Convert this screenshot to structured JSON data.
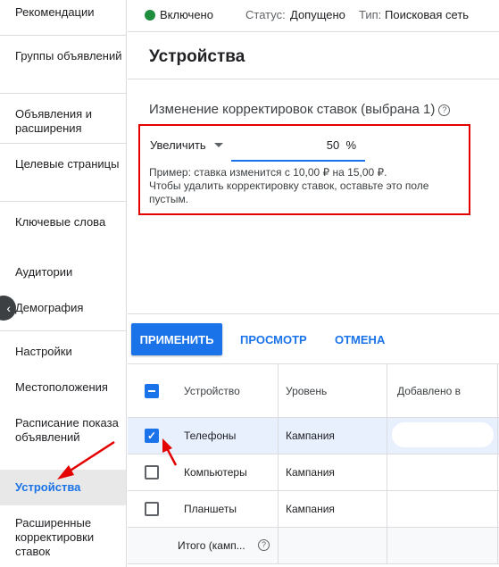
{
  "sidebar": {
    "items": [
      {
        "label": "Рекомендации"
      },
      {
        "label": "Группы объявлений"
      },
      {
        "label": "Объявления и расширения"
      },
      {
        "label": "Целевые страницы"
      },
      {
        "label": "Ключевые слова"
      },
      {
        "label": "Аудитории"
      },
      {
        "label": "Демография"
      },
      {
        "label": "Настройки"
      },
      {
        "label": "Местоположения"
      },
      {
        "label": "Расписание показа объявлений"
      },
      {
        "label": "Устройства"
      },
      {
        "label": "Расширенные корректировки ставок"
      }
    ],
    "active_index": 10
  },
  "statusbar": {
    "state": "Включено",
    "status_label": "Статус:",
    "status_value": "Допущено",
    "type_label": "Тип:",
    "type_value": "Поисковая сеть",
    "state_color": "#1e8e3e"
  },
  "header": {
    "title": "Устройства"
  },
  "panel": {
    "title": "Изменение корректировок ставок (выбрана 1)",
    "direction": "Увеличить",
    "percent_value": "50",
    "percent_unit": "%",
    "example_line1": "Пример: ставка изменится с 10,00 ₽ на 15,00 ₽.",
    "example_line2": "Чтобы удалить корректировку ставок, оставьте это поле пустым."
  },
  "actions": {
    "apply_label": "ПРИМЕНИТЬ",
    "preview_label": "ПРОСМОТР",
    "cancel_label": "ОТМЕНА"
  },
  "table": {
    "headers": {
      "device": "Устройство",
      "level": "Уровень",
      "added": "Добавлено в"
    },
    "rows": [
      {
        "device": "Телефоны",
        "level": "Кампания",
        "checked": true
      },
      {
        "device": "Компьютеры",
        "level": "Кампания",
        "checked": false
      },
      {
        "device": "Планшеты",
        "level": "Кампания",
        "checked": false
      }
    ],
    "total_label": "Итого (камп..."
  },
  "colors": {
    "accent": "#1a73e8",
    "highlight_box": "#e50000",
    "annotation_arrow": "#e50000"
  }
}
